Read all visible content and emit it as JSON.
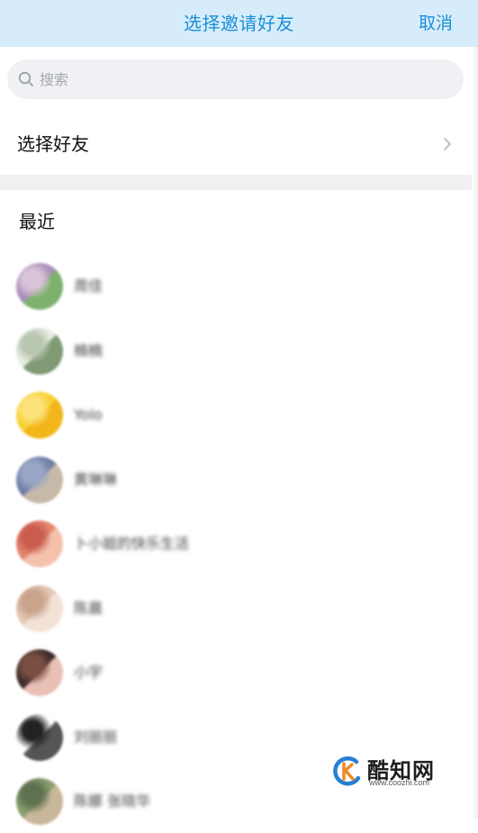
{
  "header": {
    "title": "选择邀请好友",
    "cancel_label": "取消",
    "background": "#d7ecfa",
    "accent": "#1a8fd6"
  },
  "search": {
    "placeholder": "搜索",
    "value": "",
    "icon": "search-icon"
  },
  "select_friends": {
    "label": "选择好友",
    "icon": "chevron-right-icon"
  },
  "recent": {
    "label": "最近",
    "contacts": [
      {
        "name": "周佳",
        "avatar_colors": [
          "#a98fb7",
          "#7cb16e",
          "#d8c3d8"
        ]
      },
      {
        "name": "楠楠",
        "avatar_colors": [
          "#e8ece4",
          "#7f9a74",
          "#b8c7b0"
        ]
      },
      {
        "name": "Yolo",
        "avatar_colors": [
          "#f7d233",
          "#f2b51a",
          "#fce27a"
        ]
      },
      {
        "name": "黄琳琳",
        "avatar_colors": [
          "#6f7fa6",
          "#c7b9a7",
          "#9aa7c6"
        ]
      },
      {
        "name": "卜小姐的快乐生活",
        "avatar_colors": [
          "#e7876f",
          "#f5c1ad",
          "#c95c4f"
        ]
      },
      {
        "name": "陈晨",
        "avatar_colors": [
          "#e4c7b4",
          "#f3e2d6",
          "#c9a38c"
        ]
      },
      {
        "name": "小宇",
        "avatar_colors": [
          "#3b2c2a",
          "#e9c0b6",
          "#7a4f43"
        ]
      },
      {
        "name": "刘丽丽",
        "avatar_colors": [
          "#ffffff",
          "#555555",
          "#222222"
        ]
      },
      {
        "name": "陈娜 张晓华",
        "avatar_colors": [
          "#8aa06e",
          "#c8b79a",
          "#5f7150"
        ]
      }
    ]
  },
  "watermark": {
    "brand": "酷知网",
    "url": "www.coozhi.com",
    "colors": [
      "#f08a24",
      "#2b7fd2"
    ]
  }
}
